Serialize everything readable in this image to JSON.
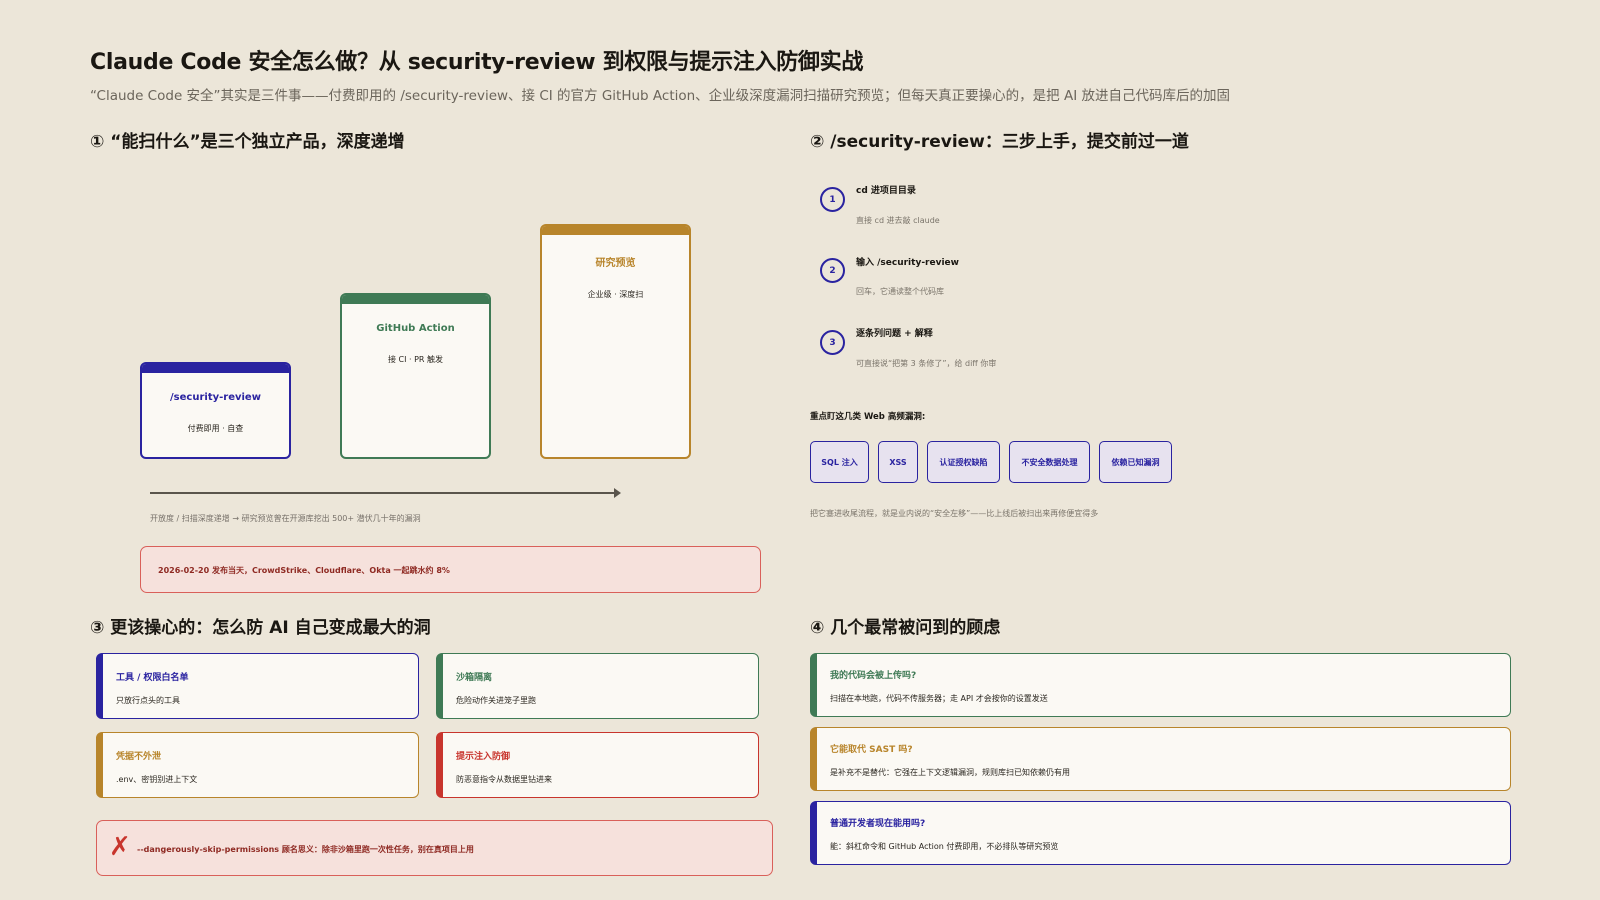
{
  "header": {
    "title": "Claude Code 安全怎么做？从 security-review 到权限与提示注入防御实战",
    "subtitle": "“Claude Code 安全”其实是三件事——付费即用的 /security-review、接 CI 的官方 GitHub Action、企业级深度漏洞扫描研究预览；但每天真正要操心的，是把 AI 放进自己代码库后的加固"
  },
  "colors": {
    "navy": "#2a23a0",
    "green": "#3f7a55",
    "gold": "#b8852b",
    "red": "#c8352d",
    "background": "#ece6d9"
  },
  "section1": {
    "heading": "① “能扫什么”是三个独立产品，深度递增",
    "pillars": [
      {
        "name": "/security-review",
        "desc": "付费即用 · 自查",
        "color": "#2a23a0"
      },
      {
        "name": "GitHub Action",
        "desc": "接 CI · PR 触发",
        "color": "#3f7a55"
      },
      {
        "name": "研究预览",
        "desc": "企业级 · 深度扫",
        "color": "#b8852b"
      }
    ],
    "axis_caption": "开放度 / 扫描深度递增 → 研究预览曾在开源库挖出 500+ 潜伏几十年的漏洞",
    "alert": "2026-02-20 发布当天，CrowdStrike、Cloudflare、Okta 一起跳水约 8%"
  },
  "section2": {
    "heading": "② /security-review：三步上手，提交前过一道",
    "steps": [
      {
        "num": "1",
        "title": "cd 进项目目录",
        "desc": "直接 cd 进去敲 claude"
      },
      {
        "num": "2",
        "title": "输入 /security-review",
        "desc": "回车，它通读整个代码库"
      },
      {
        "num": "3",
        "title": "逐条列问题 + 解释",
        "desc": "可直接说“把第 3 条修了”，给 diff 你审"
      }
    ],
    "vuln_label": "重点盯这几类 Web 高频漏洞:",
    "vulns": [
      "SQL 注入",
      "XSS",
      "认证授权缺陷",
      "不安全数据处理",
      "依赖已知漏洞"
    ],
    "note": "把它塞进收尾流程，就是业内说的“安全左移”——比上线后被扫出来再修便宜得多"
  },
  "section3": {
    "heading": "③ 更该操心的：怎么防 AI 自己变成最大的洞",
    "cards": [
      {
        "title": "工具 / 权限白名单",
        "desc": "只放行点头的工具",
        "color": "#2a23a0"
      },
      {
        "title": "沙箱隔离",
        "desc": "危险动作关进笼子里跑",
        "color": "#3f7a55"
      },
      {
        "title": "凭据不外泄",
        "desc": ".env、密钥别进上下文",
        "color": "#b8852b"
      },
      {
        "title": "提示注入防御",
        "desc": "防恶意指令从数据里钻进来",
        "color": "#c8352d"
      }
    ],
    "danger": "--dangerously-skip-permissions 顾名思义：除非沙箱里跑一次性任务，别在真项目上用"
  },
  "section4": {
    "heading": "④ 几个最常被问到的顾虑",
    "faqs": [
      {
        "q": "我的代码会被上传吗?",
        "a": "扫描在本地跑，代码不传服务器；走 API 才会按你的设置发送",
        "color": "#3f7a55"
      },
      {
        "q": "它能取代 SAST 吗?",
        "a": "是补充不是替代：它强在上下文逻辑漏洞，规则库扫已知依赖仍有用",
        "color": "#b8852b"
      },
      {
        "q": "普通开发者现在能用吗?",
        "a": "能：斜杠命令和 GitHub Action 付费即用，不必排队等研究预览",
        "color": "#2a23a0"
      }
    ]
  }
}
